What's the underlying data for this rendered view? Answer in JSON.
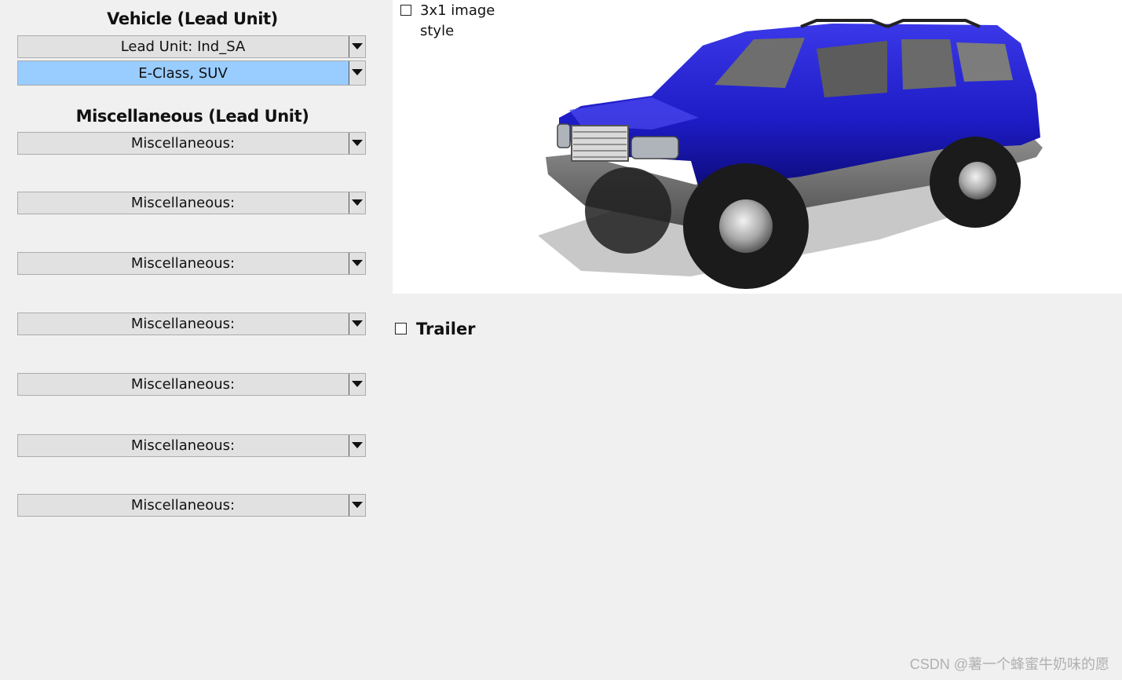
{
  "vehicle_section": {
    "title": "Vehicle (Lead Unit)",
    "lead_unit_dropdown": "Lead Unit: Ind_SA",
    "vehicle_dropdown": "E-Class, SUV"
  },
  "misc_section": {
    "title": "Miscellaneous (Lead Unit)",
    "dropdowns": [
      "Miscellaneous:",
      "Miscellaneous:",
      "Miscellaneous:",
      "Miscellaneous:",
      "Miscellaneous:",
      "Miscellaneous:",
      "Miscellaneous:"
    ]
  },
  "image_panel": {
    "style_checkbox_line1": "3x1 image",
    "style_checkbox_line2": "style",
    "style_checked": false,
    "vehicle_color": "#1d1bc4"
  },
  "trailer": {
    "label": "Trailer",
    "checked": false
  },
  "watermark": "CSDN @薯一个蜂蜜牛奶味的愿",
  "colors": {
    "selected_bg": "#99ccff",
    "panel_bg": "#f0f0f0"
  }
}
